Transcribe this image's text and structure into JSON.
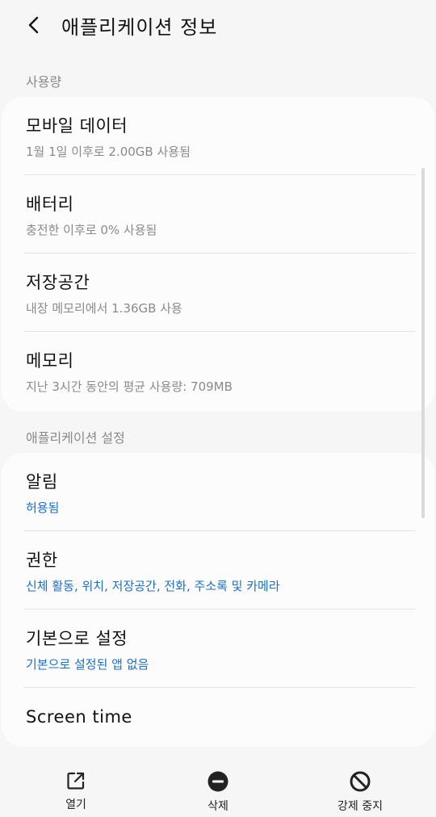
{
  "header": {
    "title": "애플리케이션 정보"
  },
  "sections": {
    "usage_label": "사용량",
    "settings_label": "애플리케이션 설정"
  },
  "usage": [
    {
      "title": "모바일 데이터",
      "subtitle": "1월 1일 이후로 2.00GB 사용됨"
    },
    {
      "title": "배터리",
      "subtitle": "충전한 이후로 0% 사용됨"
    },
    {
      "title": "저장공간",
      "subtitle": "내장 메모리에서 1.36GB 사용"
    },
    {
      "title": "메모리",
      "subtitle": "지난 3시간 동안의 평균 사용량: 709MB"
    }
  ],
  "settings": [
    {
      "title": "알림",
      "subtitle": "허용됨"
    },
    {
      "title": "권한",
      "subtitle": "신체 활동, 위치, 저장공간, 전화, 주소록 및 카메라"
    },
    {
      "title": "기본으로 설정",
      "subtitle": "기본으로 설정된 앱 없음"
    },
    {
      "title": "Screen time"
    }
  ],
  "bottom_actions": {
    "open": "열기",
    "delete": "삭제",
    "force_stop": "강제 중지"
  },
  "colors": {
    "accent_blue": "#1b6fc9",
    "secondary_text": "#8a8a8a",
    "card_bg": "#fcfcfc",
    "page_bg": "#f6f6f6"
  }
}
